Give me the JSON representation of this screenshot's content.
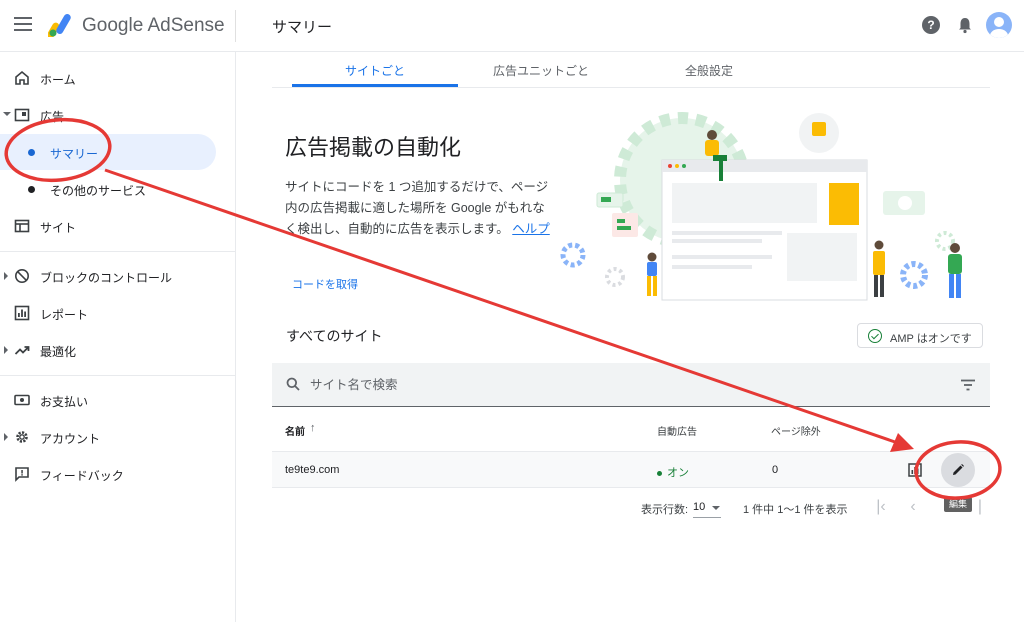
{
  "header": {
    "brand": "Google AdSense",
    "page_title": "サマリー"
  },
  "sidebar": {
    "items": [
      {
        "label": "ホーム",
        "icon": "home-icon"
      },
      {
        "label": "広告",
        "icon": "ads-icon"
      },
      {
        "label": "サマリー"
      },
      {
        "label": "その他のサービス"
      },
      {
        "label": "サイト",
        "icon": "sites-icon"
      },
      {
        "label": "ブロックのコントロール",
        "icon": "block-icon"
      },
      {
        "label": "レポート",
        "icon": "report-icon"
      },
      {
        "label": "最適化",
        "icon": "trending-icon"
      },
      {
        "label": "お支払い",
        "icon": "payments-icon"
      },
      {
        "label": "アカウント",
        "icon": "settings-icon"
      },
      {
        "label": "フィードバック",
        "icon": "feedback-icon"
      }
    ]
  },
  "tabs": [
    {
      "label": "サイトごと",
      "active": true
    },
    {
      "label": "広告ユニットごと",
      "active": false
    },
    {
      "label": "全般設定",
      "active": false
    }
  ],
  "hero": {
    "title": "広告掲載の自動化",
    "description": "サイトにコードを 1 つ追加するだけで、ページ内の広告掲載に適した場所を Google がもれなく検出し、自動的に広告を表示します。",
    "help_link": "ヘルプ",
    "get_code": "コードを取得"
  },
  "sites": {
    "heading": "すべてのサイト",
    "amp_status": "AMP はオンです",
    "search_placeholder": "サイト名で検索",
    "columns": [
      "名前",
      "自動広告",
      "ページ除外"
    ],
    "rows": [
      {
        "name": "te9te9.com",
        "auto_ads": "オン",
        "page_exclusions": "0"
      }
    ],
    "edit_tooltip": "編集"
  },
  "pagination": {
    "rows_label": "表示行数:",
    "rows_value": "10",
    "range_text": "1 件中 1〜1 件を表示"
  },
  "colors": {
    "accent": "#1a73e8",
    "active_bg": "#e8f0fe",
    "status_green": "#188038",
    "annotation_red": "#e53935"
  }
}
